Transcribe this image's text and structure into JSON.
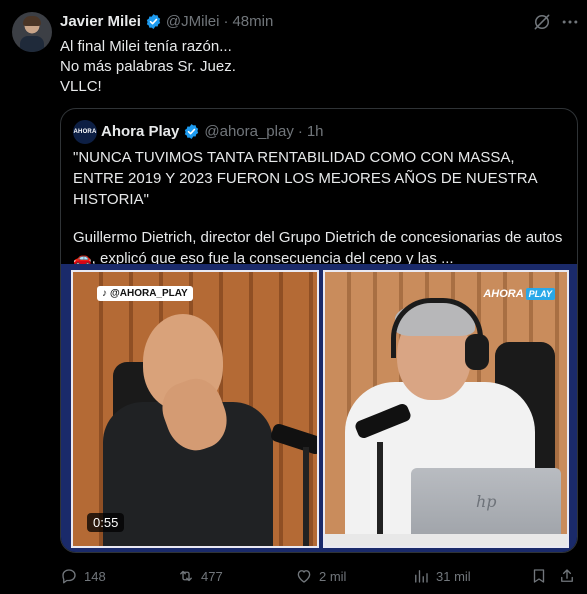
{
  "author": {
    "name": "Javier Milei",
    "handle": "@JMilei",
    "separator": "·",
    "time": "48min"
  },
  "tweet": {
    "lines": [
      "Al final Milei tenía razón...",
      "No más palabras Sr. Juez.",
      "VLLC!"
    ]
  },
  "quote": {
    "avatar_text": "AHORA",
    "name": "Ahora Play",
    "handle": "@ahora_play",
    "separator": "·",
    "time": "1h",
    "paragraph1": "\"NUNCA TUVIMOS TANTA RENTABILIDAD COMO CON MASSA, ENTRE 2019 Y 2023 FUERON LOS MEJORES AÑOS DE NUESTRA HISTORIA\"",
    "paragraph2": "Guillermo Dietrich, director del Grupo Dietrich de concesionarias de autos🚗, explicó que eso fue la consecuencia del cepo y las ...",
    "media": {
      "watermark": "@AHORA_PLAY",
      "brand_left": "AHORA",
      "brand_right": "PLAY",
      "duration": "0:55"
    }
  },
  "actions": {
    "replies": "148",
    "reposts": "477",
    "likes": "2 mil",
    "views": "31 mil"
  },
  "colors": {
    "background": "#000000",
    "text": "#e7e9ea",
    "muted": "#71767b",
    "verified": "#1d9bf0",
    "border": "#2f3336"
  }
}
